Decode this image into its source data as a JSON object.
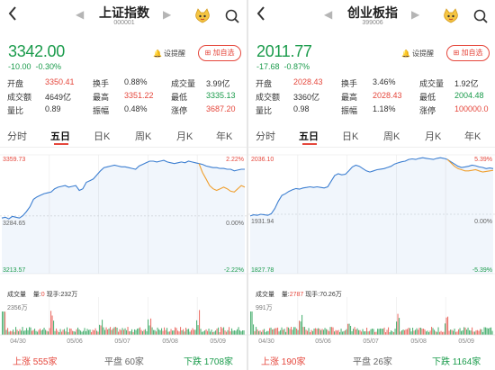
{
  "panels": [
    {
      "title": "上证指数",
      "code": "000001",
      "price": "3342.00",
      "change": "-10.00",
      "change_pct": "-0.30%",
      "alert_label": "设提醒",
      "fav_label": "加自选",
      "quotes": [
        {
          "k": "开盘",
          "v": "3350.41",
          "color": "red"
        },
        {
          "k": "换手",
          "v": "0.88%",
          "color": "plain"
        },
        {
          "k": "成交量",
          "v": "3.99亿",
          "color": "plain"
        },
        {
          "k": "成交额",
          "v": "4649亿",
          "color": "plain"
        },
        {
          "k": "最高",
          "v": "3351.22",
          "color": "red"
        },
        {
          "k": "最低",
          "v": "3335.13",
          "color": "green"
        },
        {
          "k": "量比",
          "v": "0.89",
          "color": "plain"
        },
        {
          "k": "振幅",
          "v": "0.48%",
          "color": "plain"
        },
        {
          "k": "涨停",
          "v": "3687.20",
          "color": "red"
        }
      ],
      "tabs": [
        "分时",
        "五日",
        "日K",
        "周K",
        "月K",
        "年K"
      ],
      "active_tab": 1,
      "volume_header": {
        "label": "成交量",
        "prefix": "量:",
        "value": "0",
        "mid": " 现手:",
        "hand": "232万"
      },
      "volume_max": "2356万",
      "dates": [
        "04/30",
        "05/06",
        "05/07",
        "05/08",
        "05/09"
      ],
      "footer": {
        "up_label": "上涨",
        "up": "555家",
        "flat_label": "平盘",
        "flat": "60家",
        "down_label": "下跌",
        "down": "1708家"
      }
    },
    {
      "title": "创业板指",
      "code": "399006",
      "price": "2011.77",
      "change": "-17.68",
      "change_pct": "-0.87%",
      "alert_label": "设提醒",
      "fav_label": "加自选",
      "quotes": [
        {
          "k": "开盘",
          "v": "2028.43",
          "color": "red"
        },
        {
          "k": "换手",
          "v": "3.46%",
          "color": "plain"
        },
        {
          "k": "成交量",
          "v": "1.92亿",
          "color": "plain"
        },
        {
          "k": "成交额",
          "v": "3360亿",
          "color": "plain"
        },
        {
          "k": "最高",
          "v": "2028.43",
          "color": "red"
        },
        {
          "k": "最低",
          "v": "2004.48",
          "color": "green"
        },
        {
          "k": "量比",
          "v": "0.98",
          "color": "plain"
        },
        {
          "k": "振幅",
          "v": "1.18%",
          "color": "plain"
        },
        {
          "k": "涨停",
          "v": "100000.0",
          "color": "red"
        }
      ],
      "tabs": [
        "分时",
        "五日",
        "日K",
        "周K",
        "月K",
        "年K"
      ],
      "active_tab": 1,
      "volume_header": {
        "label": "成交量",
        "prefix": "量:",
        "value": "2787",
        "mid": " 现手:",
        "hand": "70.26万"
      },
      "volume_max": "991万",
      "dates": [
        "04/30",
        "05/06",
        "05/07",
        "05/08",
        "05/09"
      ],
      "footer": {
        "up_label": "上涨",
        "up": "190家",
        "flat_label": "平盘",
        "flat": "26家",
        "down_label": "下跌",
        "down": "1164家"
      }
    }
  ],
  "colors": {
    "up": "#e5473c",
    "down": "#1a9b4b",
    "price_line": "#3d7fd1",
    "avg_line": "#f0a030"
  },
  "chart_data": [
    {
      "type": "line",
      "x": [
        "04/30",
        "05/06",
        "05/07",
        "05/08",
        "05/09"
      ],
      "y_labels": {
        "top": "3359.73",
        "mid": "3284.65",
        "bottom": "3213.57"
      },
      "pct_labels": {
        "top": "2.22%",
        "mid": "0.00%",
        "bottom": "-2.22%"
      },
      "ylim": [
        3213.57,
        3359.73
      ],
      "base": 3284.65,
      "series": [
        {
          "values": [
            3282,
            3283,
            3281,
            3284,
            3283,
            3282,
            3285,
            3290,
            3296,
            3305,
            3308,
            3310,
            3312,
            3313,
            3314,
            3318,
            3320,
            3321,
            3322,
            3320,
            3321,
            3322,
            3316,
            3318,
            3326,
            3328,
            3330,
            3335,
            3340,
            3344,
            3345,
            3346,
            3347,
            3346,
            3345,
            3345,
            3344,
            3343,
            3342,
            3346,
            3348,
            3350,
            3352,
            3352,
            3351,
            3352,
            3353,
            3351,
            3350,
            3349,
            3350,
            3351,
            3350,
            3352,
            3351,
            3350,
            3349,
            3348,
            3346,
            3345,
            3344,
            3344,
            3343,
            3343,
            3342,
            3342,
            3340,
            3341,
            3342,
            3342
          ]
        },
        {
          "values": [
            null,
            null,
            null,
            null,
            null,
            null,
            null,
            null,
            null,
            null,
            null,
            null,
            null,
            null,
            null,
            null,
            null,
            null,
            null,
            null,
            null,
            null,
            null,
            null,
            null,
            null,
            null,
            null,
            null,
            null,
            null,
            null,
            null,
            null,
            null,
            null,
            null,
            null,
            null,
            null,
            null,
            null,
            null,
            null,
            null,
            null,
            null,
            null,
            null,
            null,
            null,
            null,
            null,
            null,
            null,
            null,
            3349,
            3338,
            3330,
            3322,
            3318,
            3316,
            3318,
            3320,
            3318,
            3315,
            3314,
            3318,
            3322,
            3320
          ]
        }
      ]
    },
    {
      "type": "line",
      "x": [
        "04/30",
        "05/06",
        "05/07",
        "05/08",
        "05/09"
      ],
      "y_labels": {
        "top": "2036.10",
        "mid": "1931.94",
        "bottom": "1827.78"
      },
      "pct_labels": {
        "top": "5.39%",
        "mid": "0.00%",
        "bottom": "-5.39%"
      },
      "ylim": [
        1827.78,
        2036.1
      ],
      "base": 1931.94,
      "series": [
        {
          "values": [
            1929,
            1931,
            1930,
            1932,
            1931,
            1930,
            1933,
            1942,
            1955,
            1965,
            1968,
            1972,
            1975,
            1977,
            1976,
            1978,
            1979,
            1980,
            1979,
            1980,
            1979,
            1978,
            1980,
            1990,
            2000,
            2003,
            2001,
            2002,
            2008,
            2015,
            2018,
            2016,
            2012,
            2008,
            2006,
            2008,
            2010,
            2011,
            2012,
            2014,
            2016,
            2020,
            2022,
            2024,
            2025,
            2028,
            2029,
            2028,
            2030,
            2031,
            2030,
            2029,
            2028,
            2030,
            2031,
            2030,
            2028,
            2024,
            2020,
            2016,
            2014,
            2015,
            2016,
            2018,
            2017,
            2015,
            2014,
            2012,
            2013,
            2012
          ]
        },
        {
          "values": [
            null,
            null,
            null,
            null,
            null,
            null,
            null,
            null,
            null,
            null,
            null,
            null,
            null,
            null,
            null,
            null,
            null,
            null,
            null,
            null,
            null,
            null,
            null,
            null,
            null,
            null,
            null,
            null,
            null,
            null,
            null,
            null,
            null,
            null,
            null,
            null,
            null,
            null,
            null,
            null,
            null,
            null,
            null,
            null,
            null,
            null,
            null,
            null,
            null,
            null,
            null,
            null,
            null,
            null,
            null,
            null,
            2028,
            2022,
            2016,
            2012,
            2010,
            2008,
            2008,
            2009,
            2010,
            2008,
            2006,
            2007,
            2008,
            2009
          ]
        }
      ]
    }
  ]
}
